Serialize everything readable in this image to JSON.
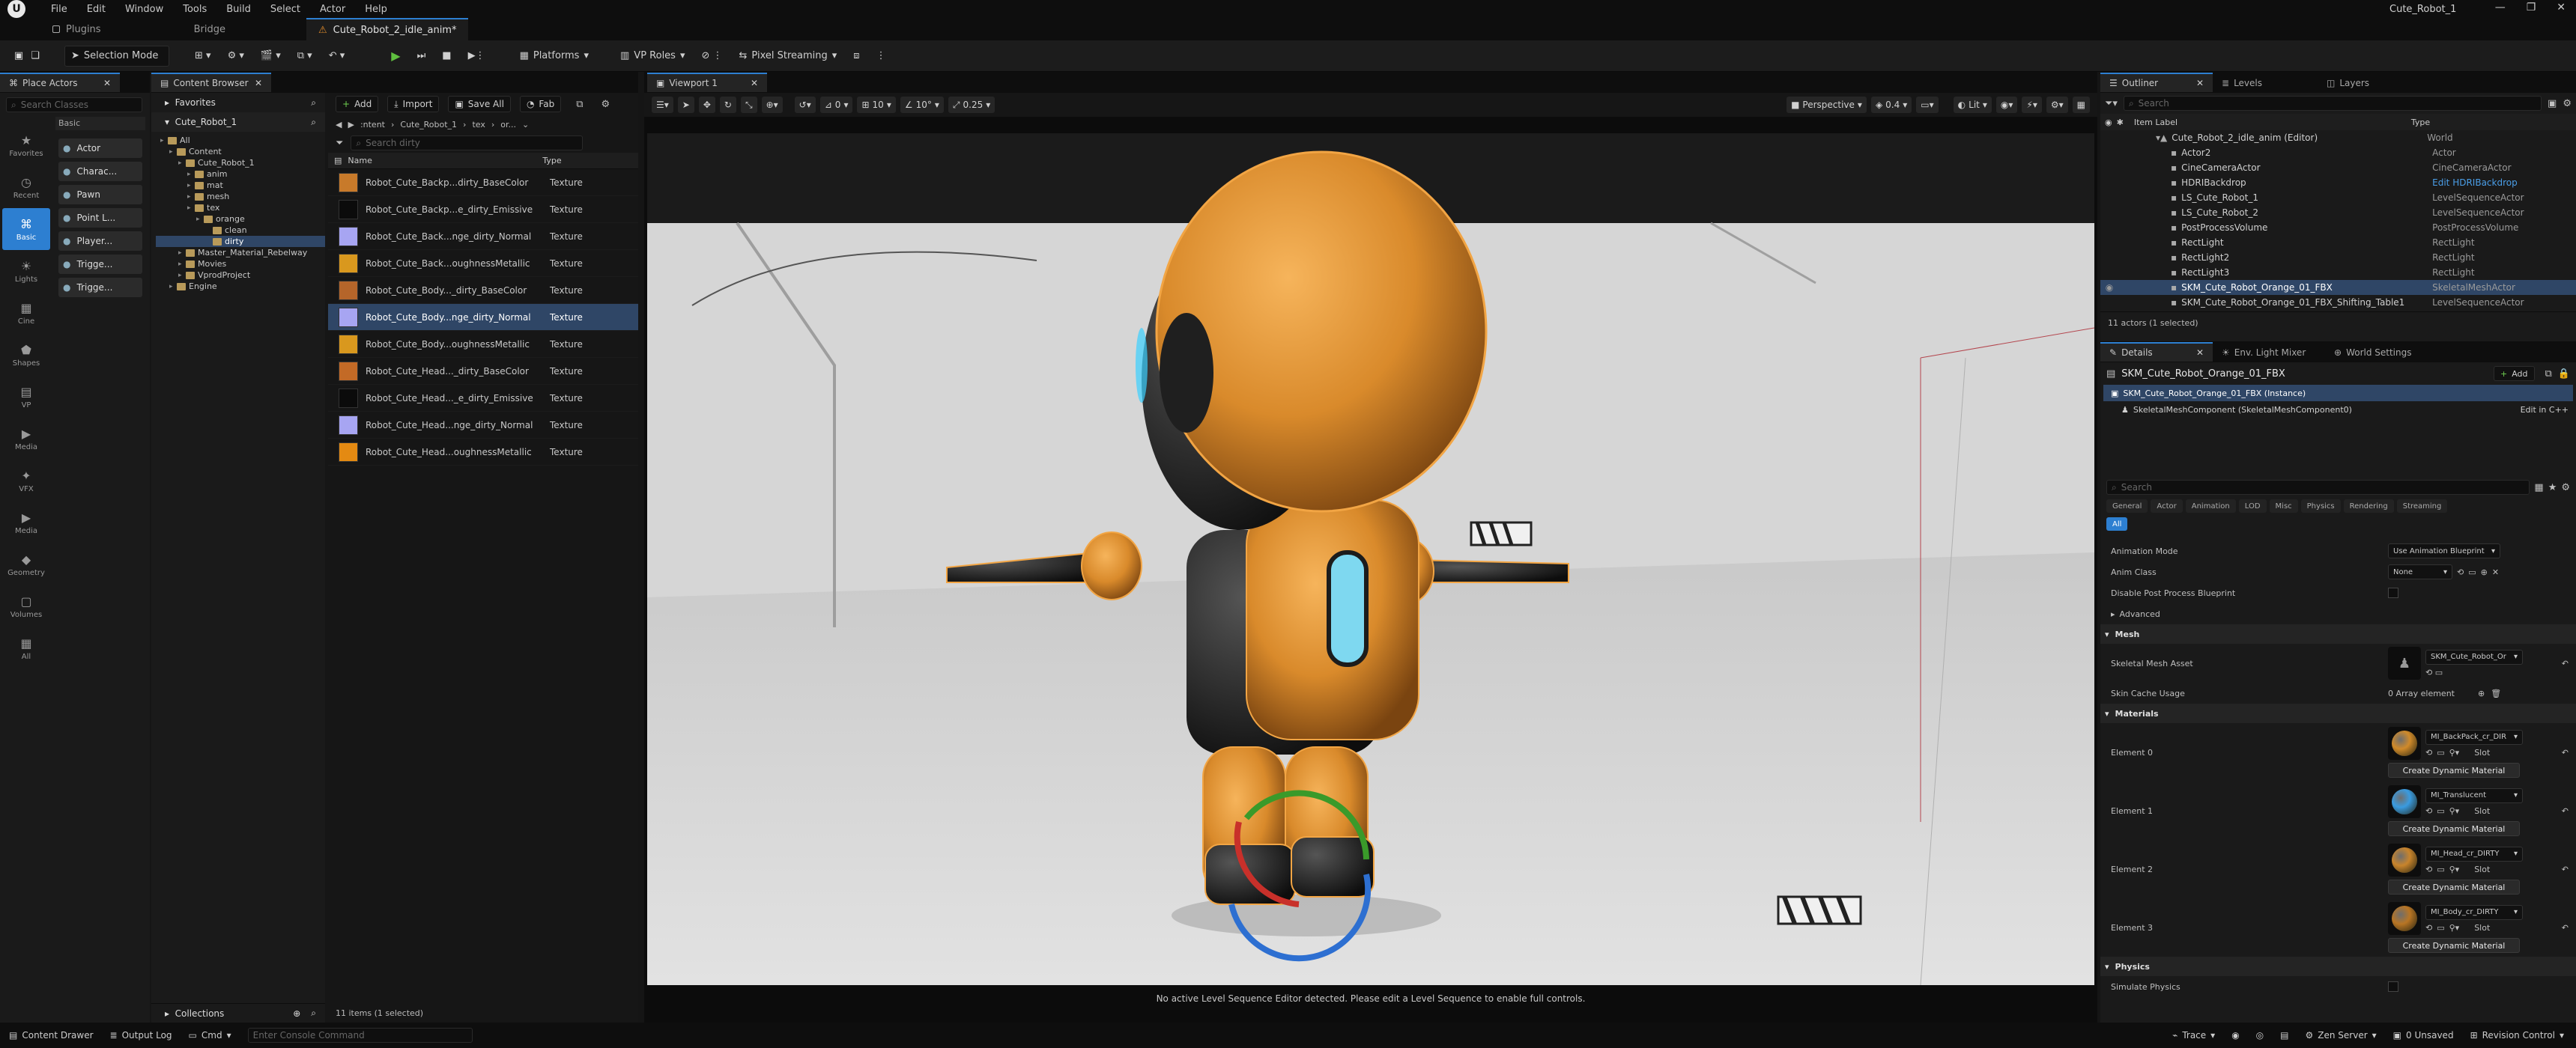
{
  "app": {
    "window_title": "Cute_Robot_1",
    "menu": [
      "File",
      "Edit",
      "Window",
      "Tools",
      "Build",
      "Select",
      "Actor",
      "Help"
    ],
    "tabs": [
      {
        "label": "Plugins"
      },
      {
        "label": "Bridge"
      },
      {
        "label": "Cute_Robot_2_idle_anim*"
      }
    ]
  },
  "toolbar": {
    "mode": "Selection Mode",
    "platforms": "Platforms",
    "vp_roles": "VP Roles",
    "pixel_streaming": "Pixel Streaming"
  },
  "place_actors": {
    "tab": "Place Actors",
    "search_placeholder": "Search Classes",
    "section": "Basic",
    "categories": [
      {
        "label": "Favorites"
      },
      {
        "label": "Recent"
      },
      {
        "label": "Basic"
      },
      {
        "label": "Lights"
      },
      {
        "label": "Cine"
      },
      {
        "label": "Shapes"
      },
      {
        "label": "VP"
      },
      {
        "label": "Media"
      },
      {
        "label": "VFX"
      },
      {
        "label": "Media"
      },
      {
        "label": "Geometry"
      },
      {
        "label": "Volumes"
      },
      {
        "label": "All"
      }
    ],
    "items": [
      "Actor",
      "Charac...",
      "Pawn",
      "Point L...",
      "Player...",
      "Trigge...",
      "Trigge..."
    ]
  },
  "content_browser": {
    "tab": "Content Browser",
    "favorites": "Favorites",
    "project": "Cute_Robot_1",
    "collections": "Collections",
    "tree": [
      {
        "label": "All",
        "d": 0
      },
      {
        "label": "Content",
        "d": 1
      },
      {
        "label": "Cute_Robot_1",
        "d": 2
      },
      {
        "label": "anim",
        "d": 3
      },
      {
        "label": "mat",
        "d": 3
      },
      {
        "label": "mesh",
        "d": 3
      },
      {
        "label": "tex",
        "d": 3
      },
      {
        "label": "orange",
        "d": 4
      },
      {
        "label": "clean",
        "d": 5
      },
      {
        "label": "dirty",
        "d": 5
      },
      {
        "label": "Master_Material_Rebelway",
        "d": 2
      },
      {
        "label": "Movies",
        "d": 2
      },
      {
        "label": "VprodProject",
        "d": 2
      },
      {
        "label": "Engine",
        "d": 1
      }
    ],
    "add": "Add",
    "import": "Import",
    "save_all": "Save All",
    "fab": "Fab",
    "path": [
      ":ntent",
      "Cute_Robot_1",
      "tex",
      "or..."
    ],
    "search_placeholder": "Search dirty",
    "col_name": "Name",
    "col_type": "Type",
    "assets": [
      {
        "name": "Robot_Cute_Backp...dirty_BaseColor",
        "type": "Texture",
        "color": "#c87a2a"
      },
      {
        "name": "Robot_Cute_Backp...e_dirty_Emissive",
        "type": "Texture",
        "color": "#0b0b0b"
      },
      {
        "name": "Robot_Cute_Back...nge_dirty_Normal",
        "type": "Texture",
        "color": "#a7a5f2"
      },
      {
        "name": "Robot_Cute_Back...oughnessMetallic",
        "type": "Texture",
        "color": "#d9981e"
      },
      {
        "name": "Robot_Cute_Body..._dirty_BaseColor",
        "type": "Texture",
        "color": "#b5652a"
      },
      {
        "name": "Robot_Cute_Body...nge_dirty_Normal",
        "type": "Texture",
        "color": "#a7a5f2"
      },
      {
        "name": "Robot_Cute_Body...oughnessMetallic",
        "type": "Texture",
        "color": "#d9981e"
      },
      {
        "name": "Robot_Cute_Head..._dirty_BaseColor",
        "type": "Texture",
        "color": "#c36a26"
      },
      {
        "name": "Robot_Cute_Head..._e_dirty_Emissive",
        "type": "Texture",
        "color": "#0b0b0b"
      },
      {
        "name": "Robot_Cute_Head...nge_dirty_Normal",
        "type": "Texture",
        "color": "#a7a5f2"
      },
      {
        "name": "Robot_Cute_Head...oughnessMetallic",
        "type": "Texture",
        "color": "#e48a12"
      }
    ],
    "status": "11 items (1 selected)"
  },
  "viewport": {
    "tab": "Viewport 1",
    "perspective": "Perspective",
    "lit": "Lit",
    "fov": "0.4",
    "grid": "10",
    "angle": "10°",
    "scale": "0.25",
    "zero": "0",
    "message": "No active Level Sequence Editor detected. Please edit a Level Sequence to enable full controls."
  },
  "outliner": {
    "tabs": [
      "Outliner",
      "Levels",
      "Layers"
    ],
    "search_placeholder": "Search",
    "col_label": "Item Label",
    "col_type": "Type",
    "rows": [
      {
        "label": "Cute_Robot_2_idle_anim (Editor)",
        "type": "World",
        "d": 0
      },
      {
        "label": "Actor2",
        "type": "Actor",
        "d": 1
      },
      {
        "label": "CineCameraActor",
        "type": "CineCameraActor",
        "d": 1
      },
      {
        "label": "HDRIBackdrop",
        "type": "Edit HDRIBackdrop",
        "d": 1
      },
      {
        "label": "LS_Cute_Robot_1",
        "type": "LevelSequenceActor",
        "d": 1
      },
      {
        "label": "LS_Cute_Robot_2",
        "type": "LevelSequenceActor",
        "d": 1
      },
      {
        "label": "PostProcessVolume",
        "type": "PostProcessVolume",
        "d": 1
      },
      {
        "label": "RectLight",
        "type": "RectLight",
        "d": 1
      },
      {
        "label": "RectLight2",
        "type": "RectLight",
        "d": 1
      },
      {
        "label": "RectLight3",
        "type": "RectLight",
        "d": 1
      },
      {
        "label": "SKM_Cute_Robot_Orange_01_FBX",
        "type": "SkeletalMeshActor",
        "d": 1
      },
      {
        "label": "SKM_Cute_Robot_Orange_01_FBX_Shifting_Table1",
        "type": "LevelSequenceActor",
        "d": 1
      }
    ],
    "status": "11 actors (1 selected)"
  },
  "details": {
    "tabs": [
      "Details",
      "Env. Light Mixer",
      "World Settings"
    ],
    "actor_name": "SKM_Cute_Robot_Orange_01_FBX",
    "add": "Add",
    "instance": "SKM_Cute_Robot_Orange_01_FBX (Instance)",
    "component": "SkeletalMeshComponent (SkeletalMeshComponent0)",
    "edit_cpp": "Edit in C++",
    "search_placeholder": "Search",
    "filters": [
      "General",
      "Actor",
      "Animation",
      "LOD",
      "Misc",
      "Physics",
      "Rendering",
      "Streaming"
    ],
    "filter_all": "All",
    "animation_mode_label": "Animation Mode",
    "animation_mode": "Use Animation Blueprint",
    "anim_class_label": "Anim Class",
    "anim_class": "None",
    "disable_pp_label": "Disable Post Process Blueprint",
    "advanced": "Advanced",
    "mesh_section": "Mesh",
    "skeletal_mesh_label": "Skeletal Mesh Asset",
    "skeletal_mesh": "SKM_Cute_Robot_Or",
    "skin_cache_label": "Skin Cache Usage",
    "skin_cache": "0 Array element",
    "materials_section": "Materials",
    "create_dynamic": "Create Dynamic Material",
    "slot": "Slot",
    "materials": [
      {
        "label": "Element 0",
        "name": "MI_BackPack_cr_DIR",
        "color": "#d08a2a"
      },
      {
        "label": "Element 1",
        "name": "MI_Translucent",
        "color": "#3a9be0"
      },
      {
        "label": "Element 2",
        "name": "MI_Head_cr_DIRTY",
        "color": "#c8842c"
      },
      {
        "label": "Element 3",
        "name": "MI_Body_cr_DIRTY",
        "color": "#b87524"
      }
    ],
    "physics_section": "Physics",
    "simulate_physics": "Simulate Physics"
  },
  "statusbar": {
    "content_drawer": "Content Drawer",
    "output_log": "Output Log",
    "cmd": "Cmd",
    "console_placeholder": "Enter Console Command",
    "trace": "Trace",
    "zen": "Zen Server",
    "unsaved": "0 Unsaved",
    "revision": "Revision Control"
  }
}
